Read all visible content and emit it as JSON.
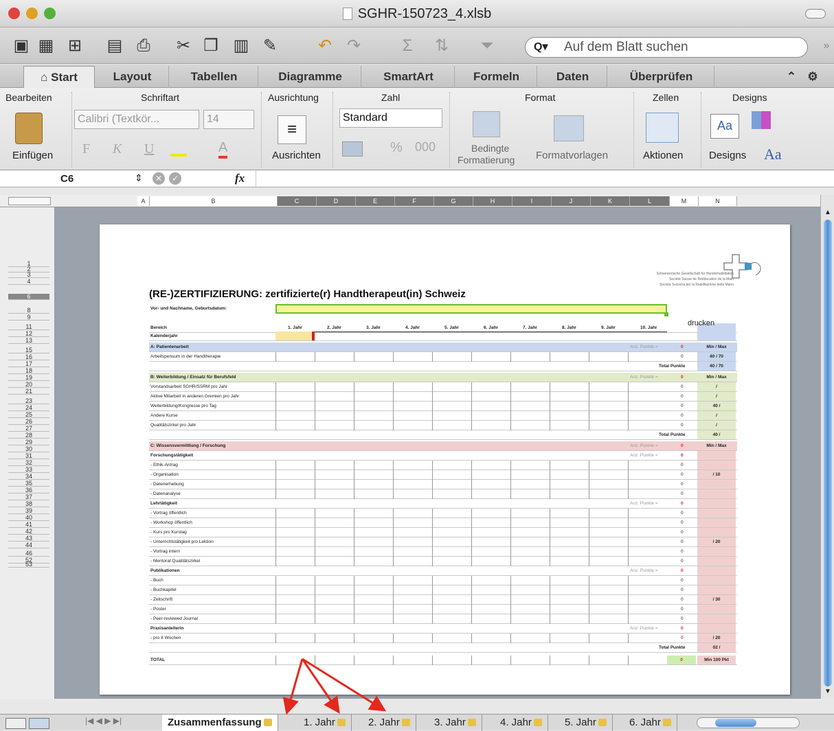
{
  "window": {
    "title": "SGHR-150723_4.xlsb"
  },
  "toolbar": {
    "search_placeholder": "Auf dem Blatt suchen"
  },
  "tabs": [
    {
      "label": "Start"
    },
    {
      "label": "Layout"
    },
    {
      "label": "Tabellen"
    },
    {
      "label": "Diagramme"
    },
    {
      "label": "SmartArt"
    },
    {
      "label": "Formeln"
    },
    {
      "label": "Daten"
    },
    {
      "label": "Überprüfen"
    }
  ],
  "ribbon": {
    "groups": [
      "Bearbeiten",
      "Schriftart",
      "Ausrichtung",
      "Zahl",
      "Format",
      "Zellen",
      "Designs"
    ],
    "paste": "Einfügen",
    "font": "Calibri (Textkör...",
    "size": "14",
    "bold": "F",
    "italic": "K",
    "underline": "U",
    "align": "Ausrichten",
    "number_format": "Standard",
    "percent": "%",
    "thousands": "000",
    "cond1": "Bedingte",
    "cond2": "Formatierung",
    "styles": "Formatvorlagen",
    "actions": "Aktionen",
    "designs": "Designs",
    "aa": "Aa"
  },
  "formula": {
    "cell": "C6",
    "fx": "fx"
  },
  "columns": [
    "A",
    "B",
    "C",
    "D",
    "E",
    "F",
    "G",
    "H",
    "I",
    "J",
    "K",
    "L",
    "M",
    "N"
  ],
  "sheet": {
    "title": "(RE-)ZERTIFIZIERUNG: zertifizierte(r) Handtherapeut(in) Schweiz",
    "org1": "Schweizerische Gesellschaft für Handrehabilitation",
    "org2": "Société Suisse de Rééducation de la Main",
    "org3": "Società Svizzera per la Riabilitazione della Mano",
    "name_label": "Vor- und Nachname, Geburtsdatum:",
    "drucken": "drucken",
    "bereich": "Bereich",
    "kalenderjahr": "Kalenderjahr",
    "years": [
      "1. Jahr",
      "2. Jahr",
      "3. Jahr",
      "4. Jahr",
      "5. Jahr",
      "6. Jahr",
      "7. Jahr",
      "8. Jahr",
      "9. Jahr",
      "10. Jahr"
    ],
    "anz": "Anz. Punkte =",
    "minmax": "Min / Max",
    "total_punkte": "Total Punkte",
    "secA": "A: Patientenarbeit",
    "a1": "Arbeitspensum in der Handtherapie",
    "a_max": "40 / 70",
    "secB": "B: Weiterbildung / Einsatz für Berufsfeld",
    "b1": "Vorstandsarbeit SGHR/SSRM pro Jahr",
    "b2": "Aktive Mitarbeit in anderen Gremien pro Jahr",
    "b3": "Weiterbildung/Kongresse pro Tag",
    "b4": "Andere Kurse",
    "b5": "Qualitätszirkel pro Jahr",
    "b_total": "40 /",
    "secC": "C: Wissensvermittlung / Forschung",
    "c_sub1": "Forschungstätigkeit",
    "c_sub2": "Lehrtätigkeit",
    "c_sub3": "Publikationen",
    "c_sub4": "Praxisanleiterin",
    "c_r10": "/ 10",
    "c_r20": "/ 20",
    "c_r30": "/ 30",
    "c_r20b": "/ 20",
    "c_total": "02 /",
    "total": "TOTAL",
    "min100": "Min 100 Pkt",
    "zero": "0"
  },
  "sheet_tabs": [
    "Zusammenfassung",
    "1. Jahr",
    "2. Jahr",
    "3. Jahr",
    "4. Jahr",
    "5. Jahr",
    "6. Jahr"
  ]
}
